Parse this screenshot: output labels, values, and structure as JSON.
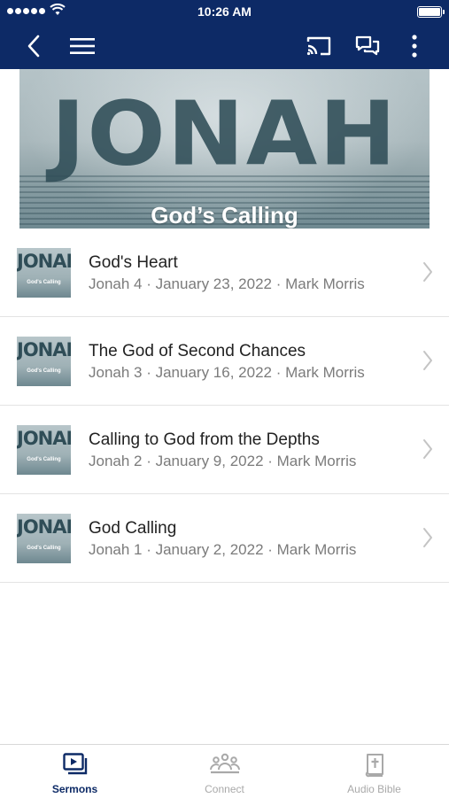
{
  "status_bar": {
    "time": "10:26 AM"
  },
  "banner": {
    "title": "JONAH",
    "subtitle": "God’s Calling"
  },
  "sermons": [
    {
      "title": "God's Heart",
      "subtitle": "Jonah 4 · January 23, 2022 · Mark Morris",
      "thumb_title": "JONAH",
      "thumb_sub": "God's Calling"
    },
    {
      "title": "The God of Second Chances",
      "subtitle": "Jonah 3 · January 16, 2022 · Mark Morris",
      "thumb_title": "JONAH",
      "thumb_sub": "God's Calling"
    },
    {
      "title": "Calling to God from the Depths",
      "subtitle": "Jonah 2 · January 9, 2022 · Mark Morris",
      "thumb_title": "JONAH",
      "thumb_sub": "God's Calling"
    },
    {
      "title": "God Calling",
      "subtitle": "Jonah 1 · January 2, 2022 · Mark Morris",
      "thumb_title": "JONAH",
      "thumb_sub": "God's Calling"
    }
  ],
  "tabs": [
    {
      "label": "Sermons",
      "icon": "sermons-play-icon",
      "active": true
    },
    {
      "label": "Connect",
      "icon": "people-icon",
      "active": false
    },
    {
      "label": "Audio Bible",
      "icon": "bible-icon",
      "active": false
    }
  ],
  "colors": {
    "nav": "#0d2a66",
    "active_tab": "#0d2a66",
    "inactive_tab": "#a9a9a9"
  }
}
